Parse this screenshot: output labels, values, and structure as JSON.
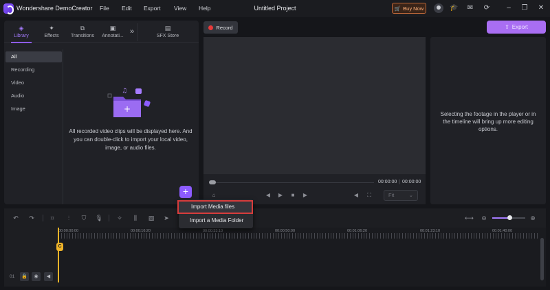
{
  "app": {
    "name": "Wondershare DemoCreator",
    "project_title": "Untitled Project"
  },
  "menu": [
    "File",
    "Edit",
    "Export",
    "View",
    "Help"
  ],
  "titlebar": {
    "buy_now": "Buy Now"
  },
  "tabs": [
    {
      "label": "Library",
      "icon": "library-icon",
      "active": true
    },
    {
      "label": "Effects",
      "icon": "effects-icon"
    },
    {
      "label": "Transitions",
      "icon": "transitions-icon"
    },
    {
      "label": "Annotati...",
      "icon": "annotation-icon"
    },
    {
      "label": "SFX Store",
      "icon": "store-icon"
    }
  ],
  "library_nav": [
    "All",
    "Recording",
    "Video",
    "Audio",
    "Image"
  ],
  "library": {
    "empty_message": "All recorded video clips will be displayed here. And you can double-click to import your local video, image, or audio files."
  },
  "record_button": "Record",
  "export_button": "Export",
  "player": {
    "current_time": "00:00:00",
    "total_time": "00:00:00",
    "zoom_option": "Fit"
  },
  "properties": {
    "hint": "Selecting the footage in the player or in the timeline will bring up more editing options."
  },
  "timeline": {
    "ticks": [
      "00:00:00:00",
      "00:00:16:20",
      "00:00:33:10",
      "00:00:50:00",
      "00:01:06:20",
      "00:01:23:10",
      "00:01:40:00"
    ],
    "track_number": "01",
    "playhead_label": "C"
  },
  "dropdown": {
    "items": [
      "Import Media files",
      "Import a Media Folder"
    ]
  },
  "colors": {
    "accent": "#8d5cff",
    "export": "#a96ef3",
    "playhead": "#f0b429",
    "highlight_border": "#d83c3c"
  }
}
